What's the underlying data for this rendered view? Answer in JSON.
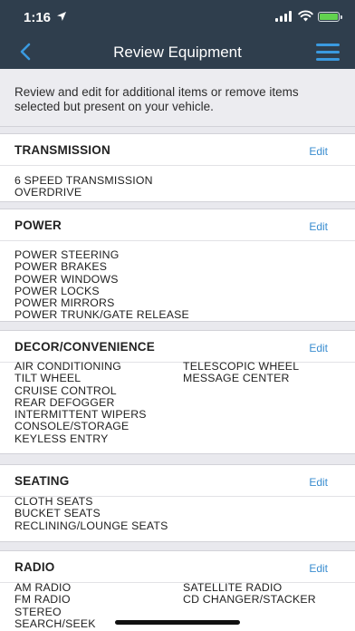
{
  "status": {
    "time": "1:16"
  },
  "nav": {
    "title": "Review Equipment",
    "back_icon": "chevron-left-icon",
    "menu_icon": "hamburger-menu-icon",
    "accent": "#3a9ae0",
    "bar_color": "#2f3e4d"
  },
  "intro": {
    "text": "Review and edit for additional items or remove items selected but present on your vehicle."
  },
  "sections": [
    {
      "title": "TRANSMISSION",
      "edit_label": "Edit",
      "left_items": [
        "6 SPEED TRANSMISSION",
        "OVERDRIVE"
      ],
      "right_items": []
    },
    {
      "title": "POWER",
      "edit_label": "Edit",
      "left_items": [
        "POWER STEERING",
        "POWER BRAKES",
        "POWER WINDOWS",
        "POWER LOCKS",
        "POWER MIRRORS",
        "POWER TRUNK/GATE RELEASE"
      ],
      "right_items": []
    },
    {
      "title": "DECOR/CONVENIENCE",
      "edit_label": "Edit",
      "left_items": [
        "AIR CONDITIONING",
        "TILT WHEEL",
        "CRUISE CONTROL",
        "REAR DEFOGGER",
        "INTERMITTENT WIPERS",
        "CONSOLE/STORAGE",
        "KEYLESS ENTRY"
      ],
      "right_items": [
        "TELESCOPIC WHEEL",
        "MESSAGE CENTER"
      ]
    },
    {
      "title": "SEATING",
      "edit_label": "Edit",
      "left_items": [
        "CLOTH SEATS",
        "BUCKET SEATS",
        "RECLINING/LOUNGE SEATS"
      ],
      "right_items": []
    },
    {
      "title": "RADIO",
      "edit_label": "Edit",
      "left_items": [
        "AM RADIO",
        "FM RADIO",
        "STEREO",
        "SEARCH/SEEK"
      ],
      "right_items": [
        "SATELLITE RADIO",
        "CD CHANGER/STACKER"
      ]
    }
  ]
}
